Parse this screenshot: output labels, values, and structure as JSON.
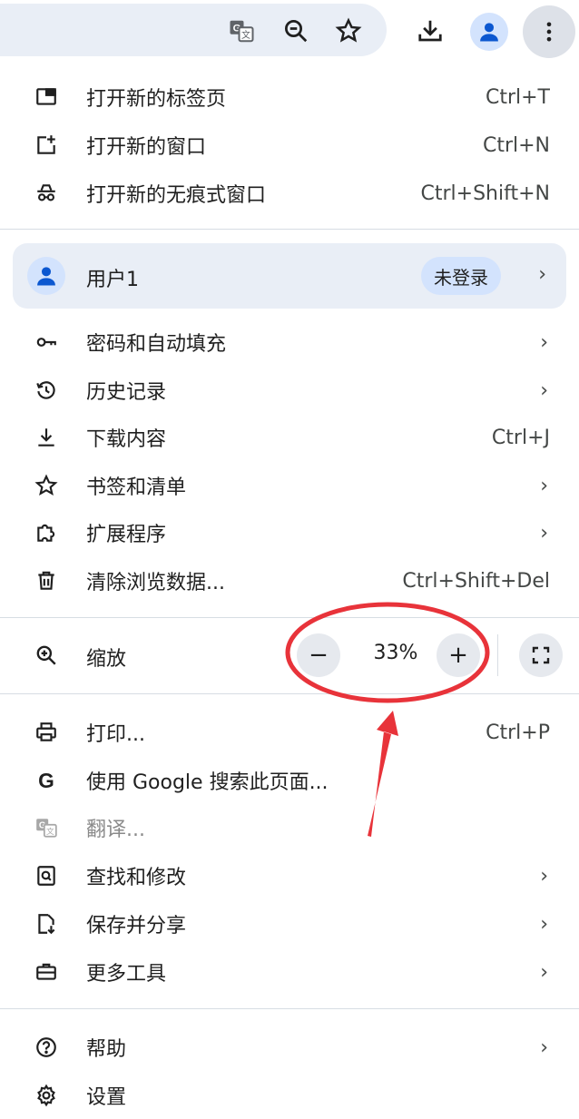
{
  "toolbar": {
    "icons": [
      "translate-icon",
      "zoom-icon",
      "star-icon",
      "download-icon",
      "avatar-icon",
      "more-vert-icon"
    ]
  },
  "menu": {
    "top_items": [
      {
        "label": "打开新的标签页",
        "shortcut": "Ctrl+T",
        "icon": "new-tab-icon"
      },
      {
        "label": "打开新的窗口",
        "shortcut": "Ctrl+N",
        "icon": "new-window-icon"
      },
      {
        "label": "打开新的无痕式窗口",
        "shortcut": "Ctrl+Shift+N",
        "icon": "incognito-icon"
      }
    ],
    "profile": {
      "label": "用户1",
      "badge": "未登录"
    },
    "mid_items": [
      {
        "label": "密码和自动填充",
        "icon": "key-icon"
      },
      {
        "label": "历史记录",
        "icon": "history-icon"
      },
      {
        "label": "下载内容",
        "shortcut": "Ctrl+J",
        "icon": "download-icon"
      },
      {
        "label": "书签和清单",
        "icon": "star-icon"
      },
      {
        "label": "扩展程序",
        "icon": "extension-icon"
      },
      {
        "label": "清除浏览数据...",
        "shortcut": "Ctrl+Shift+Del",
        "icon": "trash-icon"
      }
    ],
    "zoom": {
      "label": "缩放",
      "value": "33%",
      "minus": "−",
      "plus": "+"
    },
    "lower_items": [
      {
        "label": "打印...",
        "shortcut": "Ctrl+P",
        "icon": "print-icon"
      },
      {
        "label": "使用 Google 搜索此页面...",
        "icon": "google-icon"
      },
      {
        "label": "翻译...",
        "icon": "translate-icon",
        "disabled": true
      },
      {
        "label": "查找和修改",
        "icon": "find-icon"
      },
      {
        "label": "保存并分享",
        "icon": "save-share-icon"
      },
      {
        "label": "更多工具",
        "icon": "toolbox-icon"
      }
    ],
    "bottom_items": [
      {
        "label": "帮助",
        "icon": "help-icon"
      },
      {
        "label": "设置",
        "icon": "settings-icon"
      }
    ],
    "chevron": "›"
  },
  "colors": {
    "annotation": "#e8333a",
    "accent": "#0b57d0",
    "surface": "#e9eef6"
  }
}
